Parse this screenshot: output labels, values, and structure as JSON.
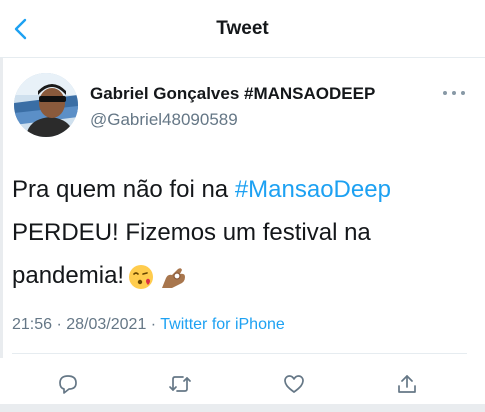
{
  "nav": {
    "title": "Tweet",
    "back_icon": "chevron-left-icon"
  },
  "tweet": {
    "author_name": "Gabriel Gonçalves #MANSAODEEP",
    "author_handle": "@Gabriel48090589",
    "text_before": "Pra quem não foi na ",
    "hashtag": "#MansaoDeep",
    "text_after": " PERDEU! Fizemos um festival na pandemia!",
    "emojis": [
      "face-blowing-kiss-emoji",
      "ok-hand-emoji"
    ],
    "timestamp": "21:56 · 28/03/2021 · ",
    "source": "Twitter for iPhone"
  },
  "actions": [
    "reply-icon",
    "retweet-icon",
    "like-icon",
    "share-icon"
  ],
  "colors": {
    "accent": "#1da1f2",
    "muted": "#657786",
    "text": "#14171a"
  }
}
